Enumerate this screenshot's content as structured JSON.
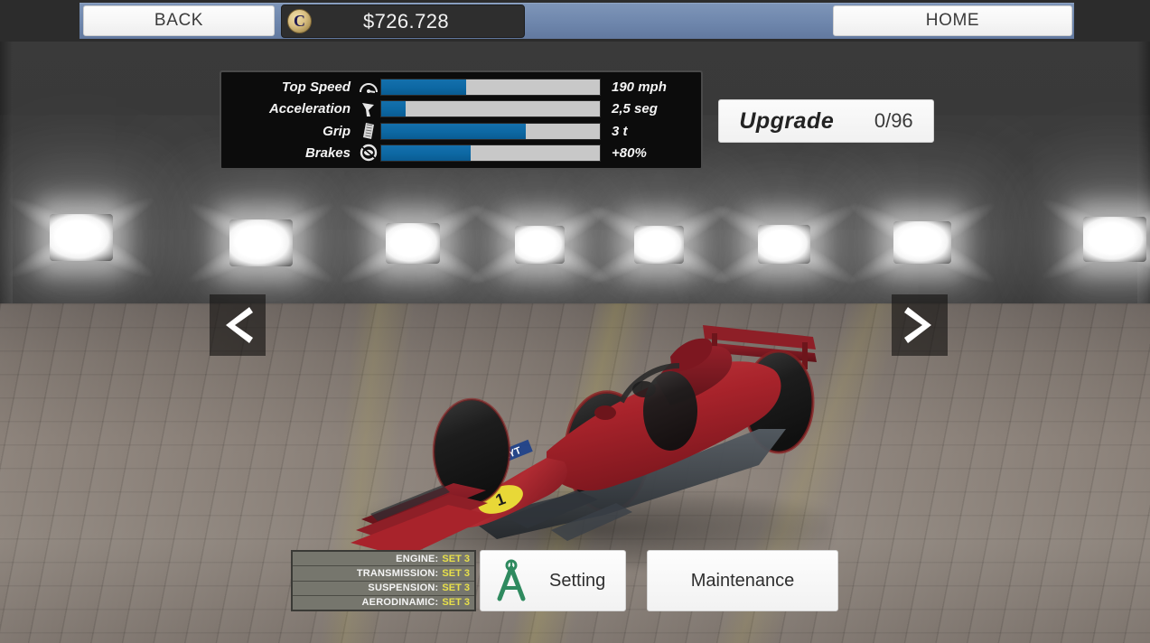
{
  "topbar": {
    "back_label": "BACK",
    "home_label": "HOME",
    "currency_symbol": "C",
    "money": "$726.728"
  },
  "stats": {
    "rows": [
      {
        "label": "Top Speed",
        "icon": "speedometer-icon",
        "value": "190 mph",
        "fill_pct": 39
      },
      {
        "label": "Acceleration",
        "icon": "pedal-icon",
        "value": "2,5 seg",
        "fill_pct": 11
      },
      {
        "label": "Grip",
        "icon": "tire-tread-icon",
        "value": "3 t",
        "fill_pct": 66
      },
      {
        "label": "Brakes",
        "icon": "brake-disc-icon",
        "value": "+80%",
        "fill_pct": 41
      }
    ]
  },
  "upgrade": {
    "label": "Upgrade",
    "count": "0/96"
  },
  "navigation": {
    "prev_icon": "chevron-left-icon",
    "next_icon": "chevron-right-icon"
  },
  "setup": {
    "rows": [
      {
        "key": "ENGINE:",
        "value": "SET 3"
      },
      {
        "key": "TRANSMISSION:",
        "value": "SET 3"
      },
      {
        "key": "SUSPENSION:",
        "value": "SET 3"
      },
      {
        "key": "AERODINAMIC:",
        "value": "SET 3"
      }
    ]
  },
  "buttons": {
    "setting_label": "Setting",
    "setting_icon": "compass-divider-icon",
    "maintenance_label": "Maintenance"
  },
  "car": {
    "number": "1",
    "sponsor_text": "1YT"
  },
  "colors": {
    "accent_blue": "#0d68a3",
    "bar_track": "#c8c8c8",
    "panel_bg": "#0c0c0c",
    "setup_value": "#e8e04a",
    "topbar_band": "#6e86ac",
    "car_red": "#a8232b"
  }
}
